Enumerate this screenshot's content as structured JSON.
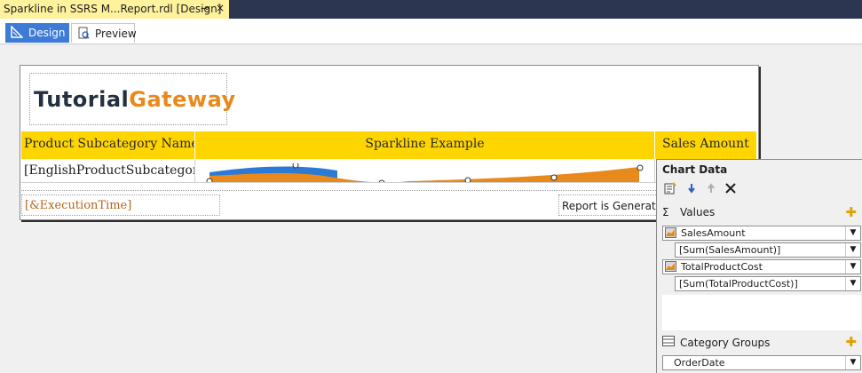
{
  "document_tab": {
    "title": "Sparkline in SSRS M...Report.rdl [Design]",
    "pin_glyph": "⊸",
    "close_glyph": "×"
  },
  "view_tabs": {
    "design_label": "Design",
    "preview_label": "Preview"
  },
  "report": {
    "logo": {
      "part1": "Tutorial",
      "part2": "Gateway"
    },
    "headers": [
      "Product Subcategory Name",
      "Sparkline Example",
      "Sales Amount"
    ],
    "row": {
      "subcategory": "[EnglishProductSubcategory"
    },
    "execution_time": "[&ExecutionTime]",
    "generated_text": "Report is Generat"
  },
  "chart_data_pane": {
    "title": "Chart Data",
    "values_section_label": "Values",
    "values": [
      {
        "series": "SalesAmount",
        "expression": "[Sum(SalesAmount)]"
      },
      {
        "series": "TotalProductCost",
        "expression": "[Sum(TotalProductCost)]"
      }
    ],
    "category_groups_label": "Category Groups",
    "category_groups": [
      "OrderDate"
    ]
  },
  "colors": {
    "header_fill": "#ffd500",
    "sparkline_area_primary": "#e8891c",
    "sparkline_area_secondary": "#2b7ad6",
    "tab_active": "#3e7bd6",
    "doc_tab": "#fff29d"
  }
}
